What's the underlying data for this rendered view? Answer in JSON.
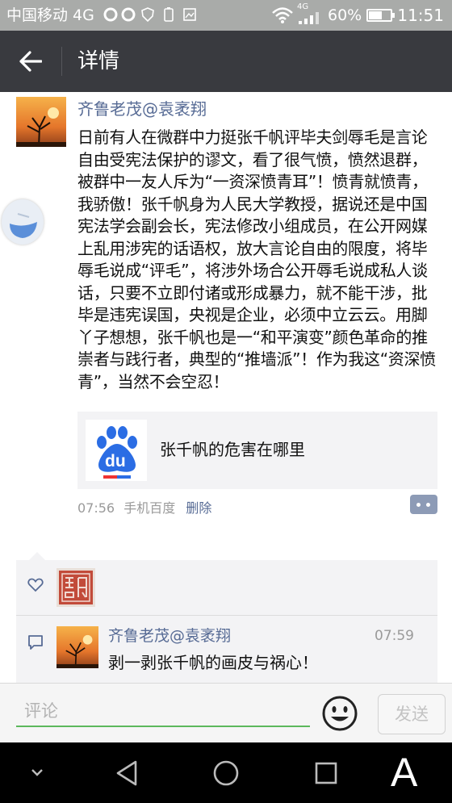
{
  "status_bar": {
    "carrier": "中国移动 4G",
    "network": "4G",
    "battery_percent": "60%",
    "time": "11:51",
    "battery_level": 0.6
  },
  "header": {
    "back_icon": "arrow-left-icon",
    "title": "详情"
  },
  "post": {
    "author": "齐鲁老茂@袁袤翔",
    "text": "日前有人在微群中力挺张千帆评毕夫剑辱毛是言论自由受宪法保护的谬文，看了很气愤，愤然退群，被群中一友人斥为“一资深愤青耳”！愤青就愤青，我骄傲！张千帆身为人民大学教授，据说还是中国宪法学会副会长，宪法修改小组成员，在公开网媒上乱用涉宪的话语权，放大言论自由的限度，将毕辱毛说成“评毛”，将涉外场合公开辱毛说成私人谈话，只要不立即付诸或形成暴力，就不能干涉，批毕是违宪误国，央视是企业，必须中立云云。用脚丫子想想，张千帆也是一“和平演变”颜色革命的推崇者与践行者，典型的“推墙派”！作为我这“资深愤青”，当然不会空忍！",
    "link": {
      "icon": "baidu-paw-icon",
      "icon_text": "du",
      "title": "张千帆的危害在哪里"
    },
    "time": "07:56",
    "source": "手机百度",
    "delete_label": "删除"
  },
  "interactions": {
    "like_icon": "heart-icon",
    "comment_icon": "comment-icon",
    "comments": [
      {
        "author": "齐鲁老茂@袁袤翔",
        "time": "07:59",
        "text": "剥一剥张千帆的画皮与祸心！"
      }
    ]
  },
  "comment_bar": {
    "placeholder": "评论",
    "send_label": "发送"
  },
  "nav_bar": {
    "keyboard_label": "A"
  },
  "colors": {
    "header_bg": "#393a3f",
    "link_blue": "#576b95",
    "input_underline": "#5cb85c",
    "baidu_blue": "#2b6de4"
  }
}
